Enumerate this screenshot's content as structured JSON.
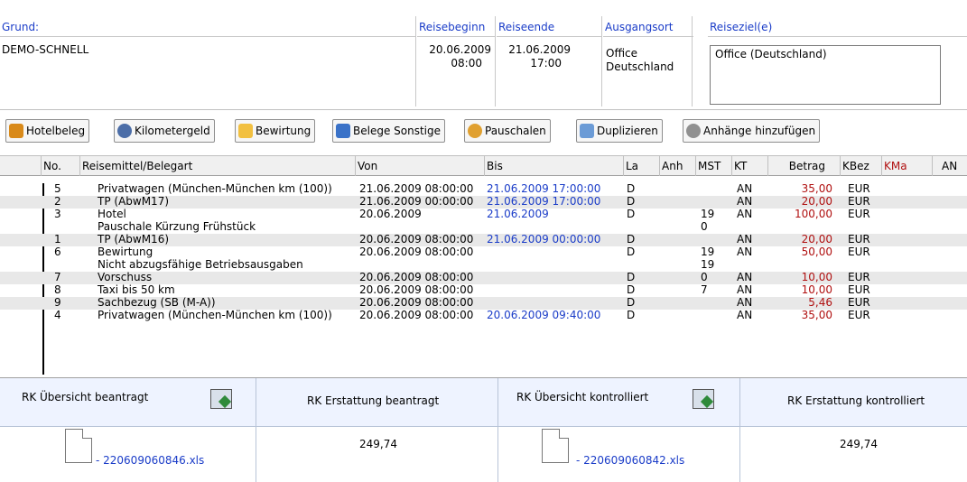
{
  "header": {
    "labels": {
      "grund": "Grund:",
      "reisebeginn": "Reisebeginn",
      "reiseende": "Reiseende",
      "ausgangsort": "Ausgangsort",
      "reiseziel": "Reiseziel(e)"
    },
    "grund": "DEMO-SCHNELL",
    "reisebeginn_date": "20.06.2009",
    "reisebeginn_time": "08:00",
    "reiseende_date": "21.06.2009",
    "reiseende_time": "17:00",
    "ausgangsort_line1": "Office",
    "ausgangsort_line2": "Deutschland",
    "reiseziel": "Office (Deutschland)"
  },
  "toolbar": {
    "hotelbeleg": "Hotelbeleg",
    "kilometergeld": "Kilometergeld",
    "bewirtung": "Bewirtung",
    "belege_sonstige": "Belege Sonstige",
    "pauschalen": "Pauschalen",
    "duplizieren": "Duplizieren",
    "anhaenge": "Anhänge hinzufügen"
  },
  "grid": {
    "columns": {
      "no": "No.",
      "belegart": "Reisemittel/Belegart",
      "von": "Von",
      "bis": "Bis",
      "la": "La",
      "anh": "Anh",
      "mst": "MST",
      "kt": "KT",
      "betrag": "Betrag",
      "kbez": "KBez",
      "kma": "KMa",
      "an": "AN"
    },
    "rows": [
      {
        "no": "5",
        "belegart": "Privatwagen (München-München km (100))",
        "sub": "",
        "von": "21.06.2009 08:00:00",
        "bis": "21.06.2009 17:00:00",
        "la": "D",
        "mst": "",
        "mst2": "",
        "kt": "AN",
        "betrag": "35,00",
        "kbez": "EUR"
      },
      {
        "no": "2",
        "belegart": "TP (AbwM17)",
        "sub": "",
        "von": "21.06.2009 00:00:00",
        "bis": "21.06.2009 17:00:00",
        "la": "D",
        "mst": "",
        "mst2": "",
        "kt": "AN",
        "betrag": "20,00",
        "kbez": "EUR"
      },
      {
        "no": "3",
        "belegart": "Hotel",
        "sub": "Pauschale Kürzung Frühstück",
        "von": "20.06.2009",
        "bis": "21.06.2009",
        "la": "D",
        "mst": "19",
        "mst2": "0",
        "kt": "AN",
        "betrag": "100,00",
        "kbez": "EUR"
      },
      {
        "no": "1",
        "belegart": "TP (AbwM16)",
        "sub": "",
        "von": "20.06.2009 08:00:00",
        "bis": "21.06.2009 00:00:00",
        "la": "D",
        "mst": "",
        "mst2": "",
        "kt": "AN",
        "betrag": "20,00",
        "kbez": "EUR"
      },
      {
        "no": "6",
        "belegart": "Bewirtung",
        "sub": "Nicht abzugsfähige Betriebsausgaben",
        "von": "20.06.2009 08:00:00",
        "bis": "",
        "la": "D",
        "mst": "19",
        "mst2": "19",
        "kt": "AN",
        "betrag": "50,00",
        "kbez": "EUR"
      },
      {
        "no": "7",
        "belegart": "Vorschuss",
        "sub": "",
        "von": "20.06.2009 08:00:00",
        "bis": "",
        "la": "D",
        "mst": "0",
        "mst2": "",
        "kt": "AN",
        "betrag": "10,00",
        "kbez": "EUR"
      },
      {
        "no": "8",
        "belegart": "Taxi bis 50 km",
        "sub": "",
        "von": "20.06.2009 08:00:00",
        "bis": "",
        "la": "D",
        "mst": "7",
        "mst2": "",
        "kt": "AN",
        "betrag": "10,00",
        "kbez": "EUR"
      },
      {
        "no": "9",
        "belegart": "Sachbezug (SB (M-A))",
        "sub": "",
        "von": "20.06.2009 08:00:00",
        "bis": "",
        "la": "D",
        "mst": "",
        "mst2": "",
        "kt": "AN",
        "betrag": "5,46",
        "kbez": "EUR"
      },
      {
        "no": "4",
        "belegart": "Privatwagen (München-München km (100))",
        "sub": "",
        "von": "20.06.2009 08:00:00",
        "bis": "20.06.2009 09:40:00",
        "la": "D",
        "mst": "",
        "mst2": "",
        "kt": "AN",
        "betrag": "35,00",
        "kbez": "EUR"
      }
    ]
  },
  "footer": {
    "panel1_title": "RK Übersicht beantragt",
    "panel1_file": "- 220609060846.xls",
    "panel2_title": "RK Erstattung beantragt",
    "panel2_value": "249,74",
    "panel3_title": "RK Übersicht kontrolliert",
    "panel3_file": "- 220609060842.xls",
    "panel4_title": "RK Erstattung kontrolliert",
    "panel4_value": "249,74"
  },
  "colors": {
    "label_blue": "#1a3cc8",
    "amount_red": "#b01010",
    "footer_bg": "#eef3ff"
  }
}
